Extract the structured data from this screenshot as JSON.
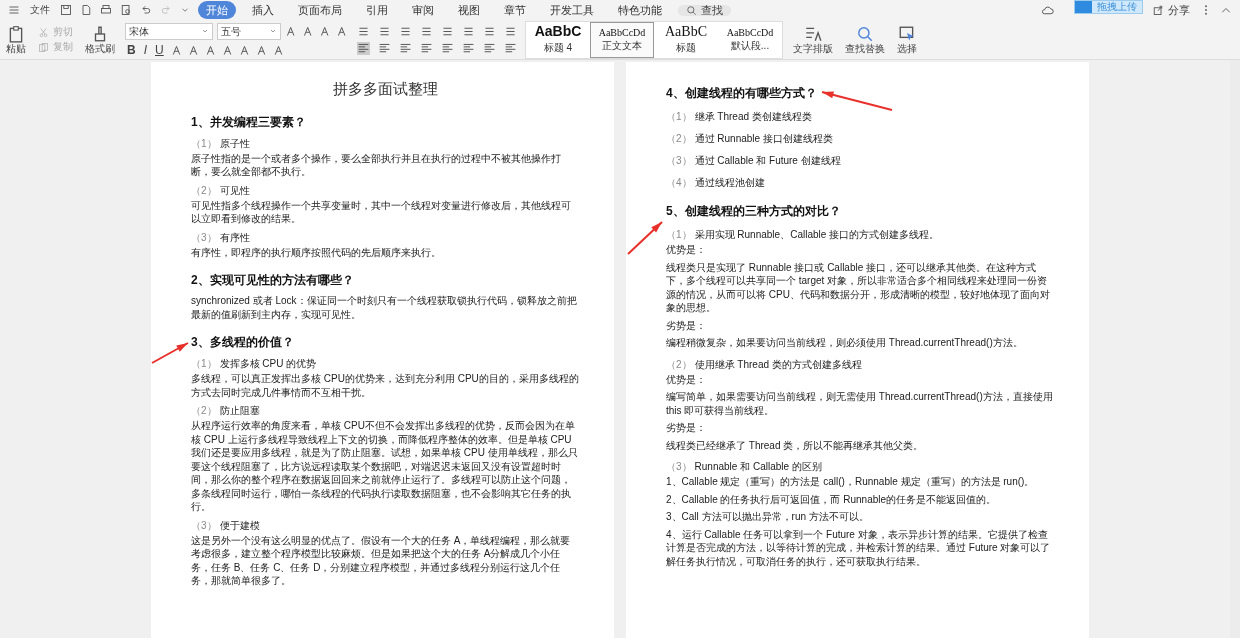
{
  "menu": {
    "file": "文件",
    "tabs": [
      {
        "label": "开始",
        "selected": true
      },
      {
        "label": "插入",
        "selected": false
      },
      {
        "label": "页面布局",
        "selected": false
      },
      {
        "label": "引用",
        "selected": false
      },
      {
        "label": "审阅",
        "selected": false
      },
      {
        "label": "视图",
        "selected": false
      },
      {
        "label": "章节",
        "selected": false
      },
      {
        "label": "开发工具",
        "selected": false
      },
      {
        "label": "特色功能",
        "selected": false
      }
    ],
    "search": "查找",
    "upload": "拖拽上传",
    "share": "分享"
  },
  "ribbon": {
    "paste": "粘贴",
    "cut": "剪切",
    "copy": "复制",
    "format_painter": "格式刷",
    "font": "宋体",
    "size": "五号",
    "format_buttons": [
      "B",
      "I",
      "U"
    ],
    "styles": [
      {
        "preview": "AaBbC",
        "label": "标题 4",
        "selected": false
      },
      {
        "preview": "AaBbCcDd",
        "label": "正文文本",
        "selected": true
      },
      {
        "preview": "AaBbC",
        "label": "标题",
        "selected": false
      },
      {
        "preview": "AaBbCcDd",
        "label": "默认段...",
        "selected": false
      }
    ],
    "layout": "文字排版",
    "find_replace": "查找替换",
    "select": "选择"
  },
  "pages": [
    {
      "blocks": [
        {
          "kind": "title",
          "text": "拼多多面试整理"
        },
        {
          "kind": "heading",
          "text": "1、并发编程三要素？"
        },
        {
          "kind": "item",
          "num": "（1）",
          "text": "原子性"
        },
        {
          "kind": "text",
          "text": "原子性指的是一个或者多个操作，要么全部执行并且在执行的过程中不被其他操作打断，要么就全部都不执行。"
        },
        {
          "kind": "item",
          "num": "（2）",
          "text": "可见性"
        },
        {
          "kind": "text",
          "text": "可见性指多个线程操作一个共享变量时，其中一个线程对变量进行修改后，其他线程可以立即看到修改的结果。"
        },
        {
          "kind": "item",
          "num": "（3）",
          "text": "有序性"
        },
        {
          "kind": "text",
          "text": "有序性，即程序的执行顺序按照代码的先后顺序来执行。"
        },
        {
          "kind": "heading",
          "text": "2、实现可见性的方法有哪些？"
        },
        {
          "kind": "text",
          "text": "synchronized 或者 Lock：保证同一个时刻只有一个线程获取锁执行代码，锁释放之前把最新的值刷新到主内存，实现可见性。"
        },
        {
          "kind": "heading",
          "text": "3、多线程的价值？"
        },
        {
          "kind": "item",
          "num": "（1）",
          "text": "发挥多核 CPU 的优势"
        },
        {
          "kind": "text",
          "text": "多线程，可以真正发挥出多核 CPU的优势来，达到充分利用 CPU的目的，采用多线程的方式去同时完成几件事情而不互相干扰。"
        },
        {
          "kind": "item",
          "num": "（2）",
          "text": "防止阻塞"
        },
        {
          "kind": "text",
          "text": "从程序运行效率的角度来看，单核 CPU不但不会发挥出多线程的优势，反而会因为在单核 CPU 上运行多线程导致线程上下文的切换，而降低程序整体的效率。但是单核 CPU 我们还是要应用多线程，就是为了防止阻塞。试想，如果单核 CPU 使用单线程，那么只要这个线程阻塞了，比方说远程读取某个数据吧，对端迟迟未返回又没有设置超时时间，那么你的整个程序在数据返回回来之前就停止运行了。多线程可以防止这个问题，多条线程同时运行，哪怕一条线程的代码执行读取数据阻塞，也不会影响其它任务的执行。"
        },
        {
          "kind": "item",
          "num": "（3）",
          "text": "便于建模"
        },
        {
          "kind": "text",
          "text": "这是另外一个没有这么明显的优点了。假设有一个大的任务 A，单线程编程，那么就要考虑很多，建立整个程序模型比较麻烦。但是如果把这个大的任务 A分解成几个小任务，任务 B、任务 C、任务 D，分别建立程序模型，并通过多线程分别运行这几个任务，那就简单很多了。"
        }
      ]
    },
    {
      "blocks": [
        {
          "kind": "heading",
          "text": "4、创建线程的有哪些方式？"
        },
        {
          "kind": "item",
          "num": "（1）",
          "text": "继承 Thread 类创建线程类"
        },
        {
          "kind": "item",
          "num": "（2）",
          "text": "通过 Runnable 接口创建线程类"
        },
        {
          "kind": "item",
          "num": "（3）",
          "text": "通过 Callable 和 Future 创建线程"
        },
        {
          "kind": "item",
          "num": "（4）",
          "text": "通过线程池创建"
        },
        {
          "kind": "heading",
          "text": "5、创建线程的三种方式的对比？"
        },
        {
          "kind": "item",
          "num": "（1）",
          "text": "采用实现 Runnable、Callable 接口的方式创建多线程。"
        },
        {
          "kind": "text",
          "text": "优势是："
        },
        {
          "kind": "text",
          "text": "线程类只是实现了 Runnable 接口或 Callable 接口，还可以继承其他类。在这种方式下，多个线程可以共享同一个 target 对象，所以非常适合多个相同线程来处理同一份资源的情况，从而可以将 CPU、代码和数据分开，形成清晰的模型，较好地体现了面向对象的思想。"
        },
        {
          "kind": "text",
          "text": "劣势是："
        },
        {
          "kind": "text",
          "text": "编程稍微复杂，如果要访问当前线程，则必须使用 Thread.currentThread()方法。"
        },
        {
          "kind": "item",
          "num": "（2）",
          "text": "使用继承 Thread 类的方式创建多线程"
        },
        {
          "kind": "text",
          "text": "优势是："
        },
        {
          "kind": "text",
          "text": "编写简单，如果需要访问当前线程，则无需使用 Thread.currentThread()方法，直接使用 this 即可获得当前线程。"
        },
        {
          "kind": "text",
          "text": "劣势是："
        },
        {
          "kind": "text",
          "text": "线程类已经继承了 Thread 类，所以不能再继承其他父类。"
        },
        {
          "kind": "item",
          "num": "（3）",
          "text": "Runnable 和 Callable 的区别"
        },
        {
          "kind": "text",
          "text": "1、Callable 规定（重写）的方法是 call()，Runnable 规定（重写）的方法是 run()。"
        },
        {
          "kind": "text",
          "text": "2、Callable 的任务执行后可返回值，而 Runnable的任务是不能返回值的。"
        },
        {
          "kind": "text",
          "text": "3、Call 方法可以抛出异常，run 方法不可以。"
        },
        {
          "kind": "text",
          "text": "4、运行 Callable 任务可以拿到一个 Future 对象，表示异步计算的结果。它提供了检查计算是否完成的方法，以等待计算的完成，并检索计算的结果。通过 Future 对象可以了解任务执行情况，可取消任务的执行，还可获取执行结果。"
        }
      ]
    }
  ]
}
